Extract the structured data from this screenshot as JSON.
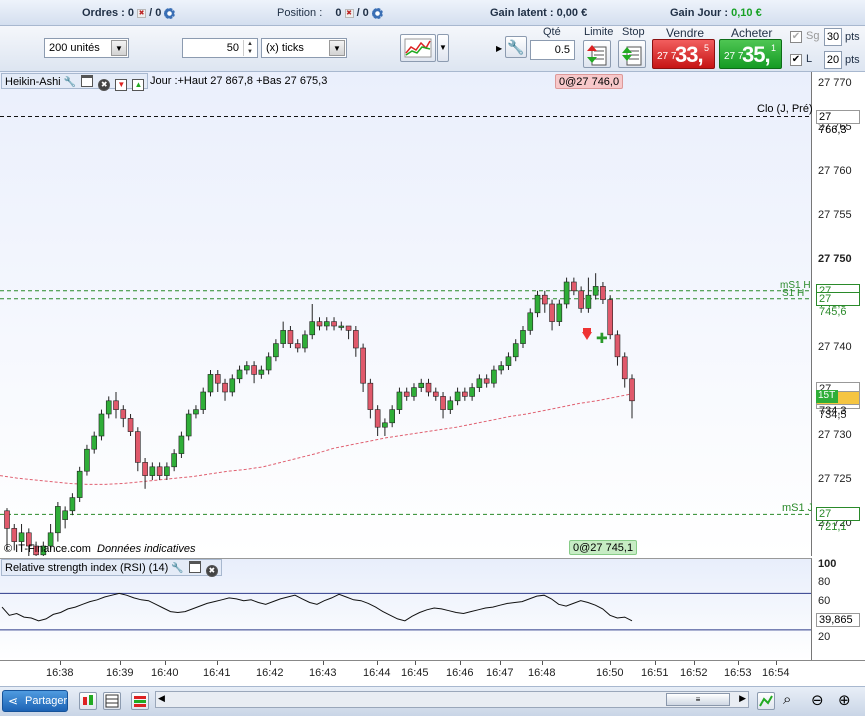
{
  "topbar": {
    "orders_label": "Ordres :",
    "orders_value": "0",
    "orders_slash": "/ 0",
    "position_label": "Position :",
    "position_value": "0",
    "position_slash": "/ 0",
    "gain_latent_label": "Gain latent :",
    "gain_latent_value": "0,00 €",
    "gain_jour_label": "Gain Jour :",
    "gain_jour_value": "0,10 €"
  },
  "toolbar": {
    "quantity_select": "200 unités",
    "ticks_value": "50",
    "ticks_unit_select": "(x) ticks",
    "qte_label": "Qté",
    "qte_value": "0.5",
    "limite_label": "Limite",
    "stop_label": "Stop",
    "vendre_label": "Vendre",
    "acheter_label": "Acheter",
    "sell_price_prefix": "27 7",
    "sell_price_big": "33,",
    "sell_price_sup": "5",
    "buy_price_prefix": "27 7",
    "buy_price_big": "35,",
    "buy_price_sup": "1",
    "sg_label": "Sg",
    "sg_pts": "30",
    "l_label": "L",
    "l_pts": "20",
    "pts_label": "pts"
  },
  "chart": {
    "indicator_name": "Heikin-Ashi",
    "day_info": "Jour :+Haut 27 867,8 +Bas 27 675,3",
    "top_tag": "0@27 746,0",
    "bottom_tag": "0@27 745,1",
    "clo_label": "Clo (J, Pré)",
    "ms1h_label": "mS1 H",
    "s1h_label": "S1 H",
    "ms1j_label": "mS1 J",
    "watermark": "© IT-Finance.com",
    "watermark_note": "Données indicatives",
    "colors": {
      "up": "#2fae38",
      "down": "#e0596b",
      "level": "#2a8a2a"
    }
  },
  "chart_data": {
    "type": "candlestick",
    "ylim": [
      27717,
      27771
    ],
    "yticks": [
      "27 770",
      "27 765",
      "27 760",
      "27 755",
      "27 750",
      "27 745",
      "27 740",
      "27 735",
      "27 730",
      "27 725",
      "27 720"
    ],
    "levels": [
      {
        "name": "Clo (J, Pré)",
        "value": "27 766,3",
        "y": 27766.3
      },
      {
        "name": "mS1 H",
        "value": "27 746,5",
        "y": 27746.5
      },
      {
        "name": "S1 H",
        "value": "27 745,6",
        "y": 27745.6
      },
      {
        "name": "mS1 J",
        "value": "27 721,1",
        "y": 27721.1
      }
    ],
    "price_boxes": [
      "27 735,3",
      "27 734,3",
      "27 734,5"
    ],
    "price_box_tag": "15T",
    "x_labels": [
      "16:38",
      "16:39",
      "16:40",
      "16:41",
      "16:42",
      "16:43",
      "16:44",
      "16:45",
      "16:46",
      "16:47",
      "16:48",
      "16:50",
      "16:51",
      "16:52",
      "16:53",
      "16:54"
    ],
    "candles": [
      [
        27721.5,
        27719.5,
        27721.8,
        27717
      ],
      [
        27719.5,
        27718,
        27720,
        27717
      ],
      [
        27718,
        27719,
        27720,
        27717
      ],
      [
        27719,
        27717.5,
        27719.5,
        27716
      ],
      [
        27717.5,
        27716.5,
        27718,
        27715
      ],
      [
        27716.5,
        27717.5,
        27718,
        27716
      ],
      [
        27717.5,
        27719,
        27720,
        27717
      ],
      [
        27719,
        27722,
        27722.5,
        27718
      ],
      [
        27720.5,
        27721.5,
        27722,
        27719.5
      ],
      [
        27721.5,
        27723,
        27723.5,
        27721
      ],
      [
        27723,
        27726,
        27726.5,
        27722.5
      ],
      [
        27726,
        27728.5,
        27729,
        27725.5
      ],
      [
        27728.5,
        27730,
        27730.5,
        27728
      ],
      [
        27730,
        27732.5,
        27733,
        27729.5
      ],
      [
        27732.5,
        27734,
        27734.5,
        27732
      ],
      [
        27734,
        27733,
        27735,
        27732
      ],
      [
        27733,
        27732,
        27733.5,
        27731
      ],
      [
        27732,
        27730.5,
        27732.5,
        27730
      ],
      [
        27730.5,
        27727,
        27731,
        27726
      ],
      [
        27727,
        27725.5,
        27727.5,
        27724
      ],
      [
        27725.5,
        27726.5,
        27727,
        27725
      ],
      [
        27726.5,
        27725.5,
        27727,
        27725
      ],
      [
        27725.5,
        27726.5,
        27727,
        27725
      ],
      [
        27726.5,
        27728,
        27728.5,
        27726
      ],
      [
        27728,
        27730,
        27730.5,
        27727.5
      ],
      [
        27730,
        27732.5,
        27733,
        27729.5
      ],
      [
        27732.5,
        27733,
        27733.5,
        27732
      ],
      [
        27733,
        27735,
        27735.5,
        27732.5
      ],
      [
        27735,
        27737,
        27737.5,
        27734.5
      ],
      [
        27737,
        27736,
        27737.5,
        27735
      ],
      [
        27736,
        27735,
        27736.5,
        27734
      ],
      [
        27735,
        27736.5,
        27737,
        27734.5
      ],
      [
        27736.5,
        27737.5,
        27738,
        27736
      ],
      [
        27737.5,
        27738,
        27738.5,
        27737
      ],
      [
        27738,
        27737,
        27738.5,
        27736
      ],
      [
        27737,
        27737.5,
        27738,
        27736.5
      ],
      [
        27737.5,
        27739,
        27739.5,
        27737
      ],
      [
        27739,
        27740.5,
        27741,
        27738.5
      ],
      [
        27740.5,
        27742,
        27743,
        27740
      ],
      [
        27742,
        27740.5,
        27742.5,
        27740
      ],
      [
        27740.5,
        27740,
        27741,
        27739.5
      ],
      [
        27740,
        27741.5,
        27742,
        27739.5
      ],
      [
        27741.5,
        27743,
        27745,
        27741
      ],
      [
        27743,
        27742.5,
        27743.5,
        27742
      ],
      [
        27742.5,
        27743,
        27743.5,
        27742
      ],
      [
        27743,
        27742.5,
        27743.5,
        27742
      ],
      [
        27742.5,
        27742.5,
        27743,
        27742
      ],
      [
        27742.5,
        27742,
        27742.5,
        27741
      ],
      [
        27742,
        27740,
        27742.5,
        27739
      ],
      [
        27740,
        27736,
        27740.5,
        27735
      ],
      [
        27736,
        27733,
        27736.5,
        27732
      ],
      [
        27733,
        27731,
        27733.5,
        27730
      ],
      [
        27731,
        27731.5,
        27732,
        27730
      ],
      [
        27731.5,
        27733,
        27733.5,
        27731
      ],
      [
        27733,
        27735,
        27735.5,
        27732.5
      ],
      [
        27735,
        27734.5,
        27735.5,
        27734
      ],
      [
        27734.5,
        27735.5,
        27736,
        27734
      ],
      [
        27735.5,
        27736,
        27736.5,
        27735
      ],
      [
        27736,
        27735,
        27736.5,
        27734.5
      ],
      [
        27735,
        27734.5,
        27735.5,
        27734
      ],
      [
        27734.5,
        27733,
        27735,
        27732
      ],
      [
        27733,
        27734,
        27734.5,
        27732.5
      ],
      [
        27734,
        27735,
        27735.5,
        27733.5
      ],
      [
        27735,
        27734.5,
        27735.5,
        27734
      ],
      [
        27734.5,
        27735.5,
        27736,
        27734
      ],
      [
        27735.5,
        27736.5,
        27737,
        27735
      ],
      [
        27736.5,
        27736,
        27737,
        27735.5
      ],
      [
        27736,
        27737.5,
        27738,
        27735.5
      ],
      [
        27737.5,
        27738,
        27738.5,
        27737
      ],
      [
        27738,
        27739,
        27739.5,
        27737.5
      ],
      [
        27739,
        27740.5,
        27741,
        27738.5
      ],
      [
        27740.5,
        27742,
        27742.5,
        27740
      ],
      [
        27742,
        27744,
        27744.5,
        27741.5
      ],
      [
        27744,
        27746,
        27746.5,
        27743.5
      ],
      [
        27746,
        27745,
        27746.5,
        27744
      ],
      [
        27745,
        27743,
        27745.5,
        27742
      ],
      [
        27743,
        27745,
        27745.5,
        27742.5
      ],
      [
        27745,
        27747.5,
        27748,
        27744.5
      ],
      [
        27747.5,
        27746.5,
        27748,
        27746
      ],
      [
        27746.5,
        27744.5,
        27747,
        27744
      ],
      [
        27744.5,
        27746,
        27748,
        27744
      ],
      [
        27746,
        27747,
        27748.5,
        27745.5
      ],
      [
        27747,
        27745.5,
        27747.5,
        27745
      ],
      [
        27745.5,
        27741.5,
        27746,
        27741
      ],
      [
        27741.5,
        27739,
        27742,
        27738
      ],
      [
        27739,
        27736.5,
        27739.5,
        27735.5
      ],
      [
        27736.5,
        27734,
        27737,
        27732
      ]
    ],
    "sma": [
      27725.5,
      27725.2,
      27725,
      27724.8,
      27724.6,
      27724.5,
      27724.5,
      27724.6,
      27724.8,
      27725,
      27725.2,
      27725.4,
      27725.7,
      27726,
      27726.2,
      27726.5,
      27727,
      27727.5,
      27728,
      27728.6,
      27729,
      27729.4,
      27729.8,
      27730.1,
      27730.4,
      27730.7,
      27731,
      27731.4,
      27731.8,
      27732.2,
      27732.5,
      27732.9,
      27733.3,
      27733.7,
      27734,
      27734.4,
      27734.8
    ],
    "rsi": {
      "title": "Relative strength index (RSI) (14)",
      "levels": [
        70,
        30
      ],
      "yticks": [
        "100",
        "80",
        "60",
        "40",
        "20"
      ],
      "last_value": "39,865",
      "values": [
        55,
        46,
        48,
        44,
        43,
        40,
        42,
        47,
        49,
        53,
        55,
        58,
        61,
        63,
        66,
        68,
        70,
        68,
        65,
        63,
        62,
        58,
        54,
        50,
        49,
        50,
        53,
        56,
        59,
        61,
        63,
        65,
        64,
        62,
        63,
        60,
        58,
        61,
        64,
        66,
        68,
        64,
        60,
        58,
        62,
        65,
        69,
        66,
        63,
        62,
        59,
        55,
        50,
        46,
        42,
        40,
        45,
        49,
        52,
        54,
        53,
        51,
        49,
        48,
        50,
        52,
        54,
        55,
        57,
        59,
        60,
        61,
        64,
        67,
        68,
        64,
        58,
        56,
        59,
        62,
        60,
        57,
        53,
        46,
        43,
        44,
        40
      ]
    }
  },
  "bottombar": {
    "share_label": "Partager"
  }
}
